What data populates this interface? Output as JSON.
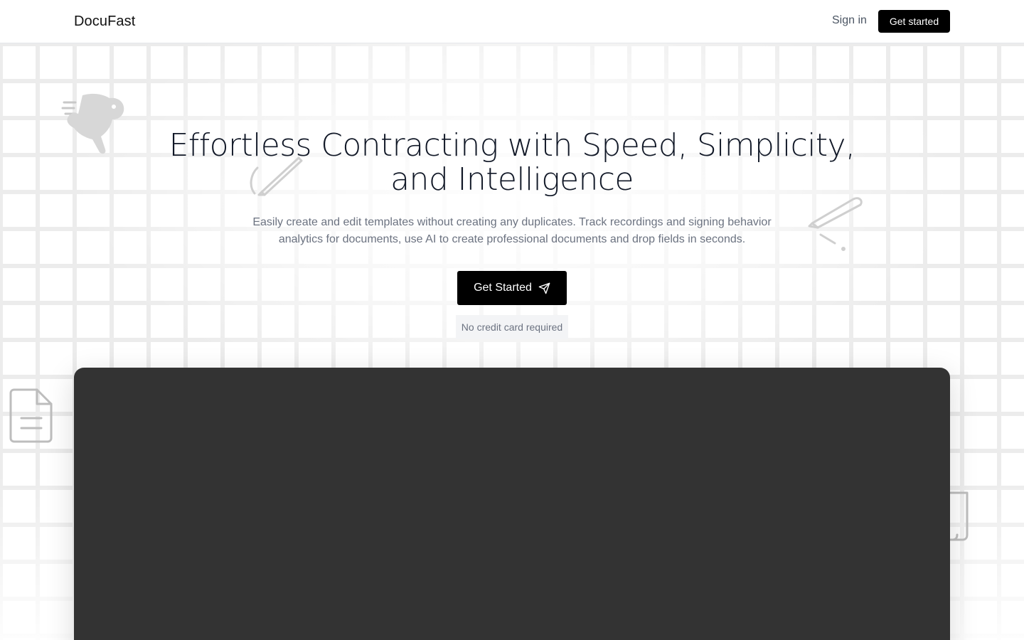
{
  "app": {
    "name": "DocuFast"
  },
  "nav": {
    "logo": "DocuFast",
    "signin_label": "Sign in",
    "cta_label": "Get started"
  },
  "hero": {
    "headline": "Effortless Contracting with Speed, Simplicity, and Intelligence",
    "subtext": "Easily create and edit templates without creating any duplicates. Track recordings and signing behavior analytics for documents, use AI to create professional documents and drop fields in seconds.",
    "cta_label": "Get Started",
    "cta_icon": "send-icon",
    "note": "No credit card required"
  },
  "decorations": {
    "icons": [
      "rabbit-icon",
      "pencil-icon",
      "pen-icon",
      "document-icon",
      "scroll-icon"
    ]
  },
  "colors": {
    "primary": "#000000",
    "text": "#111827",
    "muted": "#6b7280",
    "demo_panel": "#333333"
  }
}
